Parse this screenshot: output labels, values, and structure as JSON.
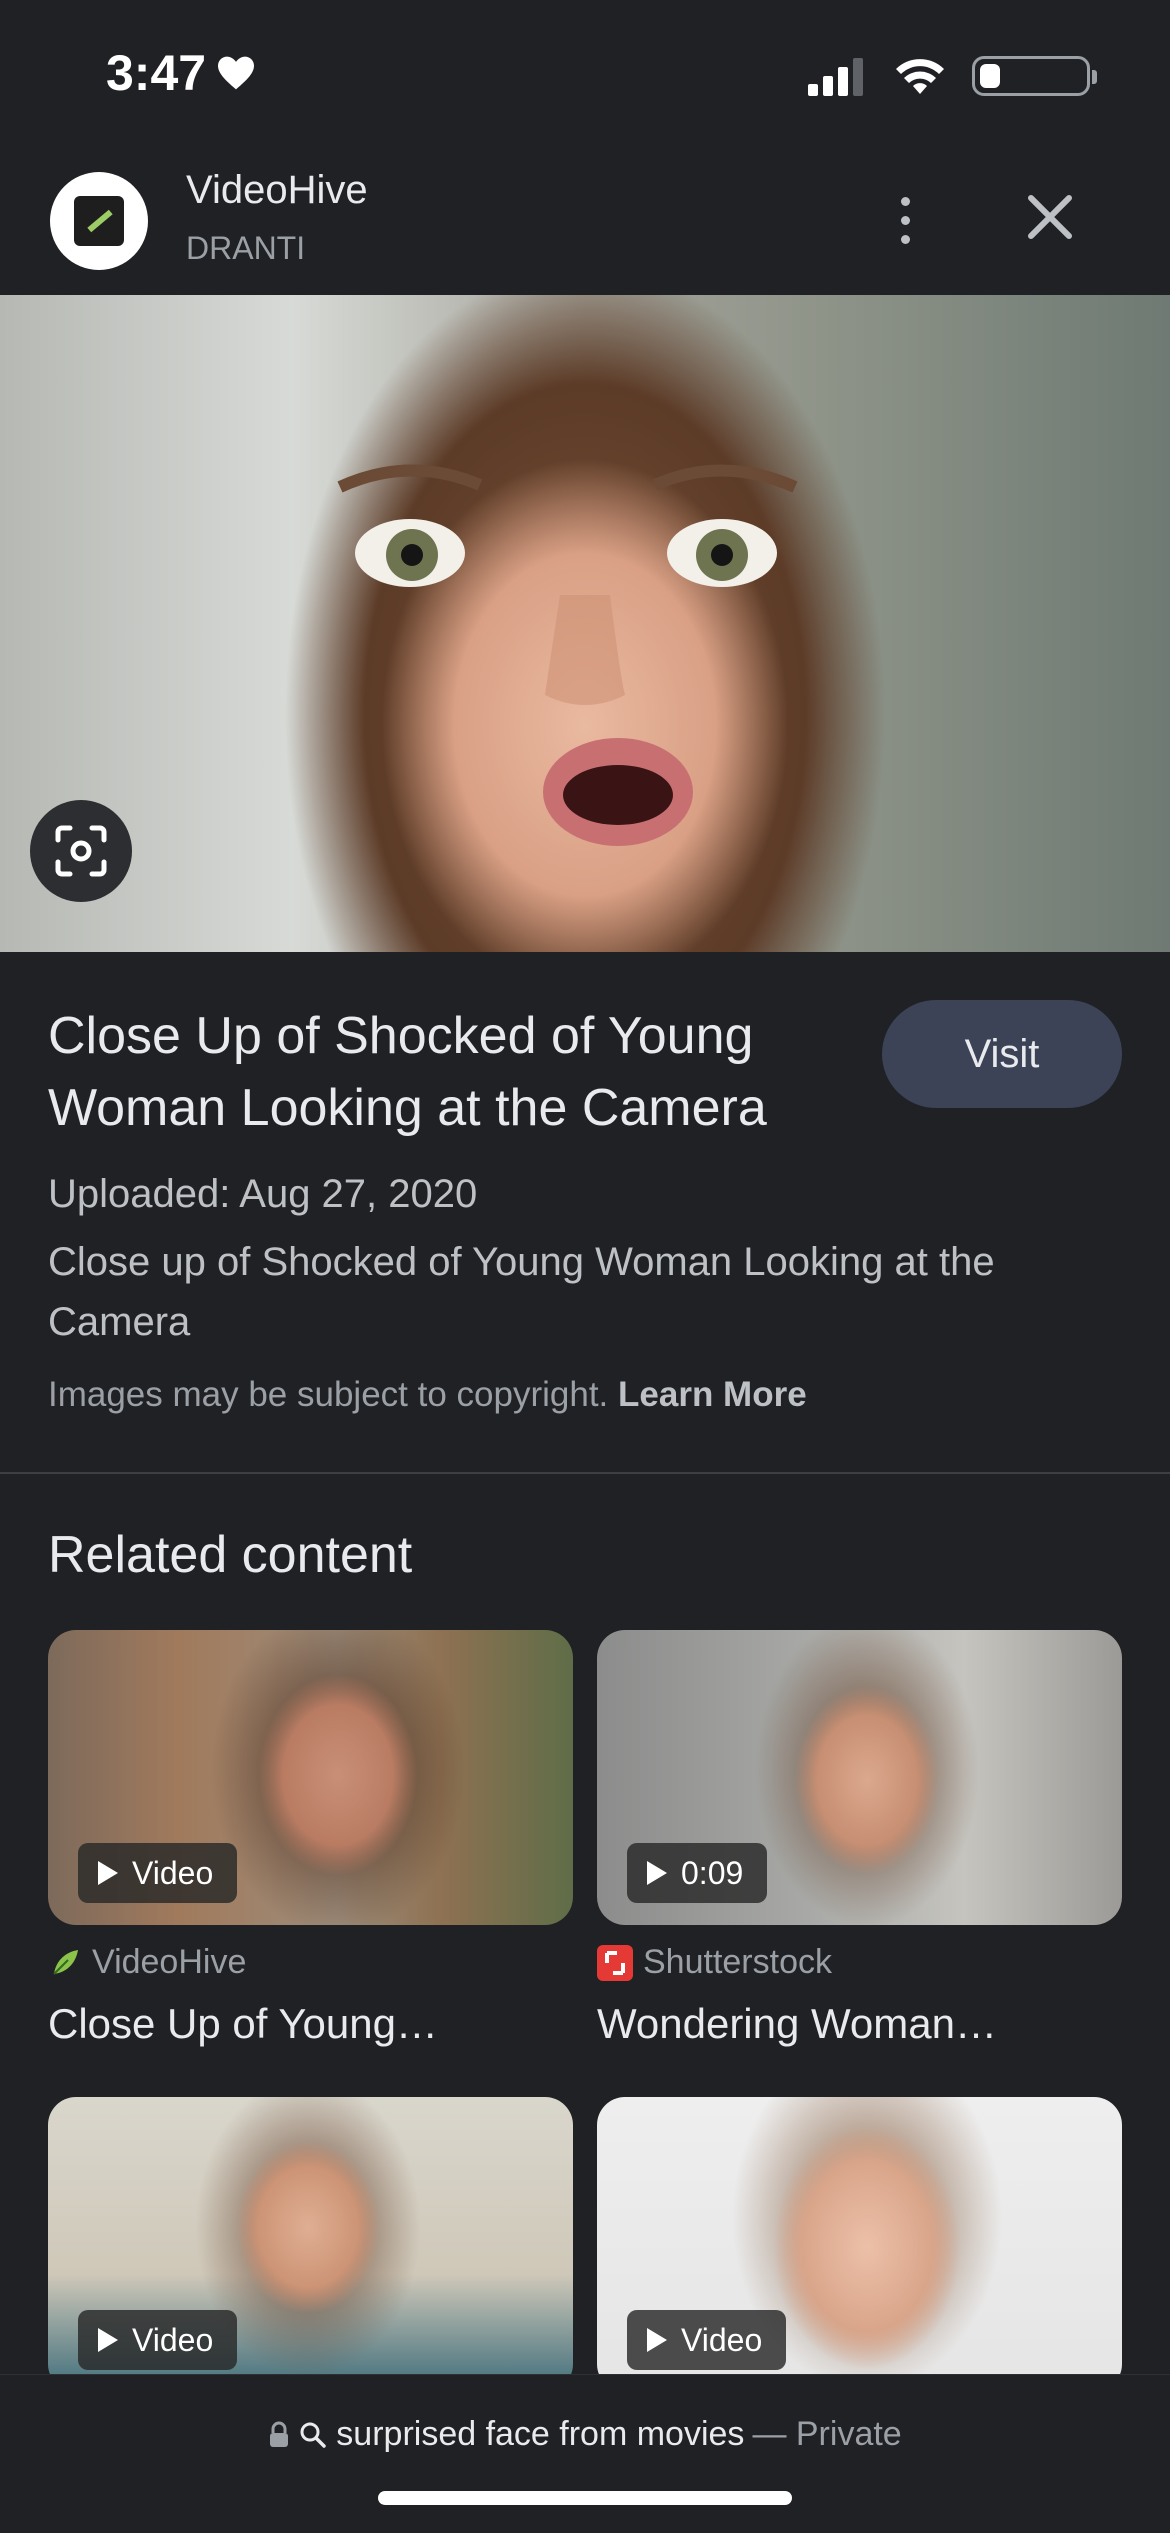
{
  "status": {
    "time": "3:47"
  },
  "header": {
    "source_name": "VideoHive",
    "source_sub": "DRANTI"
  },
  "result": {
    "title": "Close Up of Shocked of Young Woman Looking at the Camera",
    "visit_label": "Visit",
    "uploaded": "Uploaded: Aug 27, 2020",
    "description": "Close up of Shocked of Young Woman Looking at the Camera",
    "copyright_text": "Images may be subject to copyright.",
    "learn_more": "Learn More"
  },
  "related": {
    "heading": "Related content",
    "items": [
      {
        "badge": "Video",
        "source": "VideoHive",
        "title": "Close Up of Young…"
      },
      {
        "badge": "0:09",
        "source": "Shutterstock",
        "title": "Wondering Woman…"
      },
      {
        "badge": "Video"
      },
      {
        "badge": "Video"
      }
    ]
  },
  "bottom_bar": {
    "query": "surprised face from movies",
    "privacy": "— Private"
  },
  "colors": {
    "background": "#202124",
    "visit_button": "#3c4357",
    "shutterstock_red": "#e53935"
  }
}
